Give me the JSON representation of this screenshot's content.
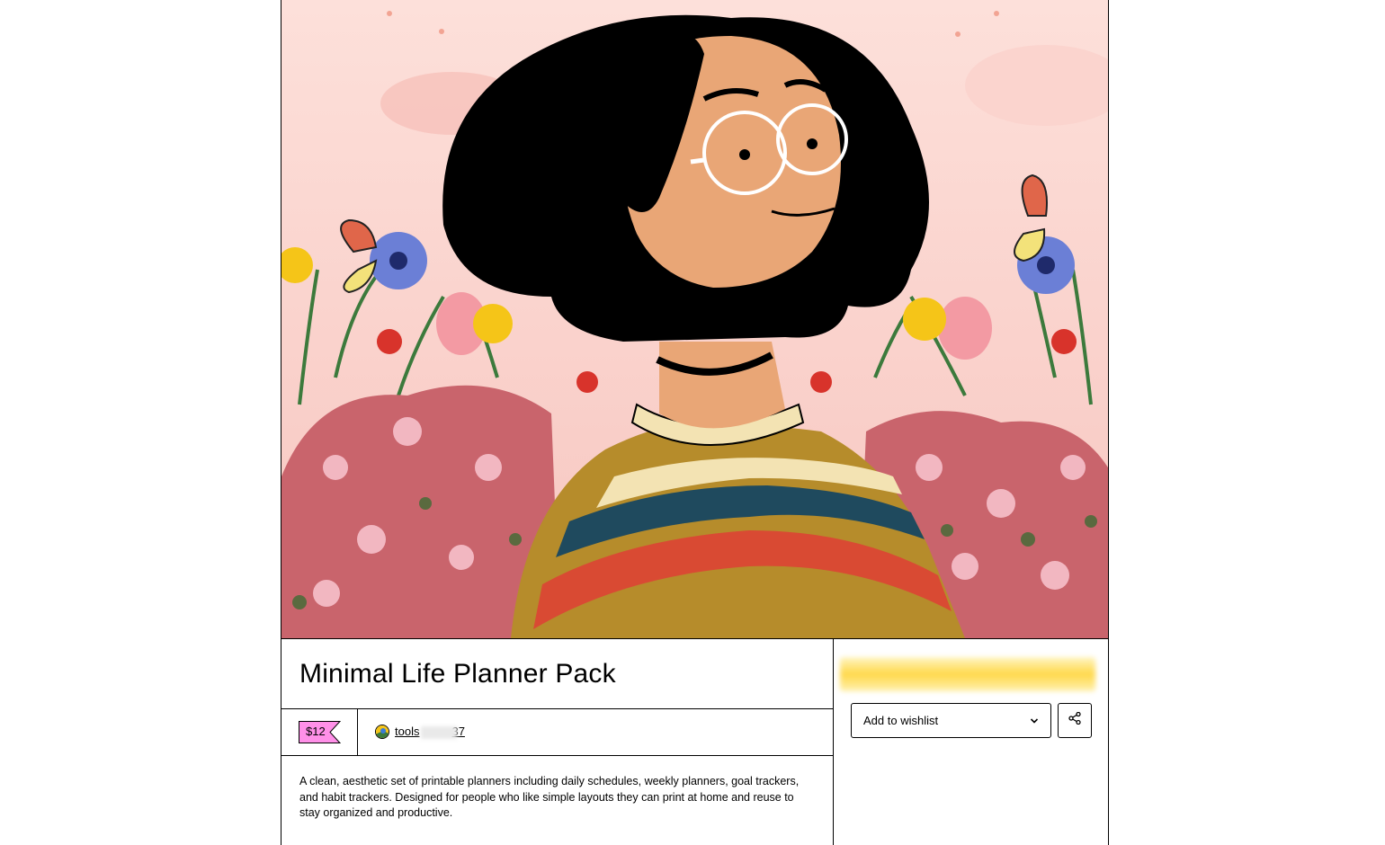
{
  "product": {
    "title": "Minimal Life Planner Pack",
    "price": "$12",
    "seller": {
      "name_start": "tools",
      "name_end": "37"
    },
    "description": "A clean, aesthetic set of printable planners including daily schedules, weekly planners, goal trackers, and habit trackers. Designed for people who like simple layouts they can print at home and reuse to stay organized and productive."
  },
  "actions": {
    "wishlist_label": "Add to wishlist",
    "wishlist_icon": "chevron-down-icon",
    "share_icon": "share-icon"
  },
  "colors": {
    "price_tag": "#ff90e8",
    "buy_button": "#ffd84a",
    "cover_background": "#fbd6cf"
  }
}
